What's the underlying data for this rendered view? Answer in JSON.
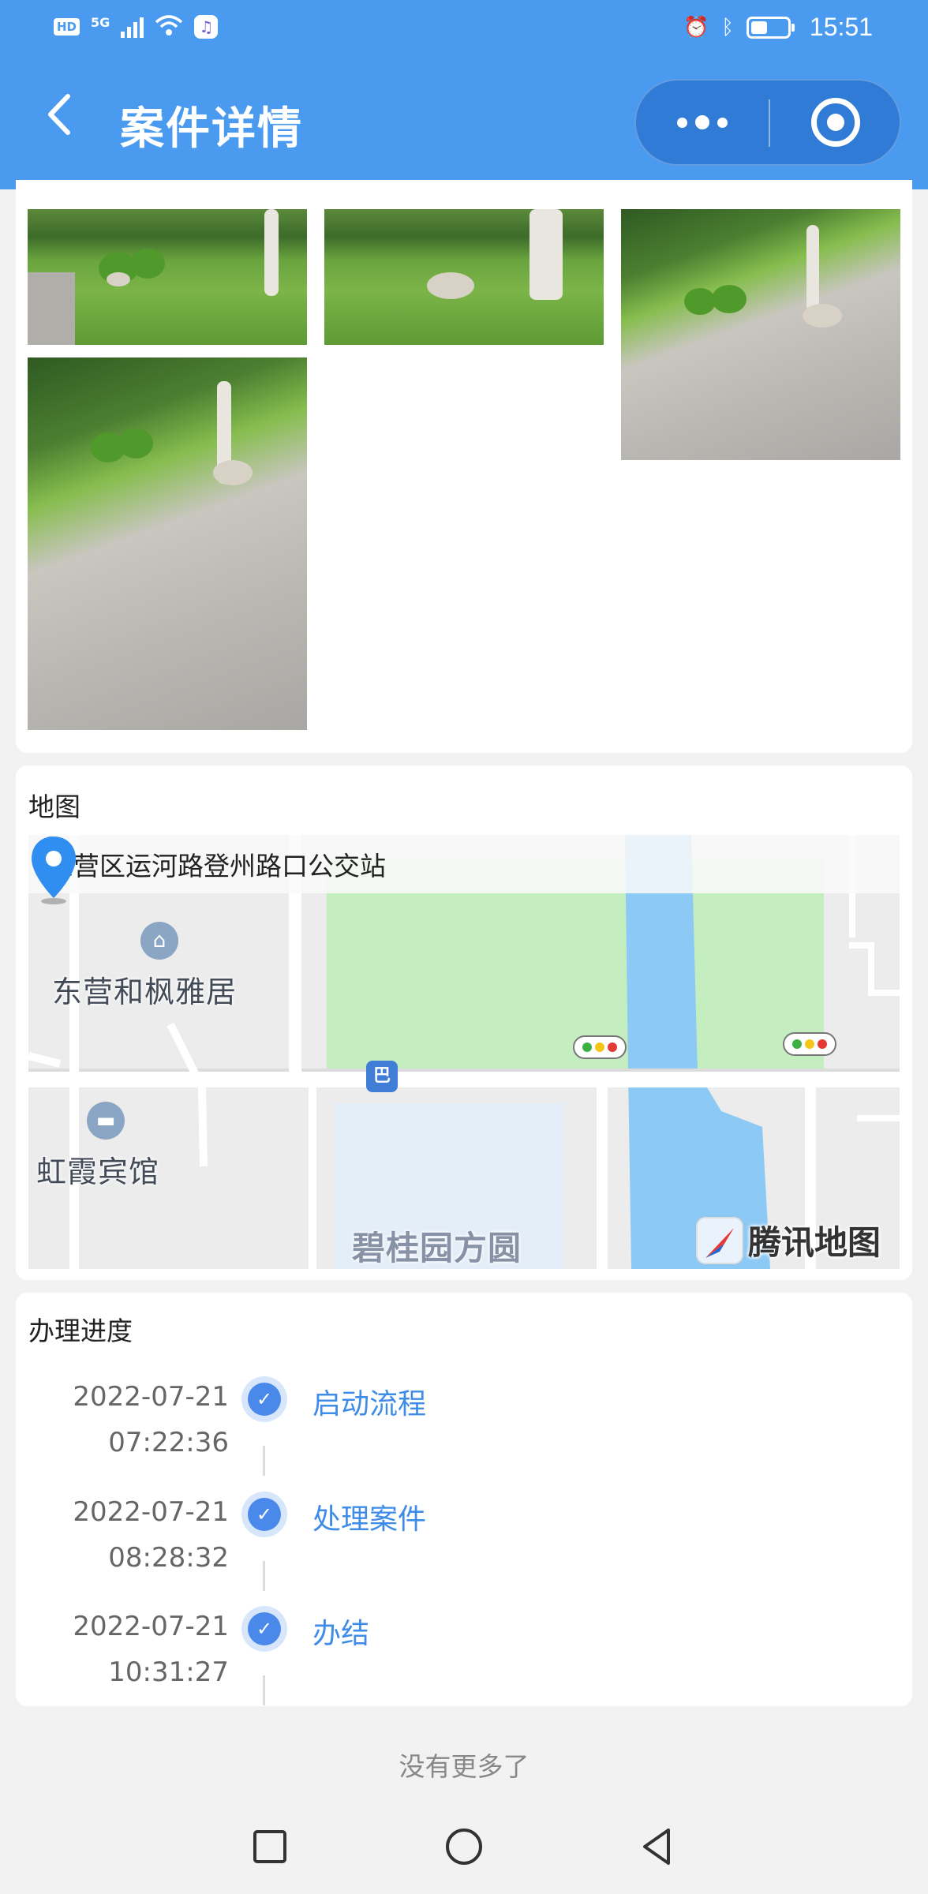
{
  "status_bar": {
    "hd": "HD",
    "network": "5G",
    "time": "15:51",
    "battery_level": 0.45
  },
  "header": {
    "title": "案件详情"
  },
  "photos_section": {
    "photo_count": 4
  },
  "map_section": {
    "title": "地图",
    "address": "东营区运河路登州路口公交站",
    "places": [
      "东营和枫雅居",
      "虹霞宾馆",
      "碧桂园方圆"
    ],
    "brand": "腾讯地图"
  },
  "progress_section": {
    "title": "办理进度",
    "steps": [
      {
        "date": "2022-07-21",
        "time": "07:22:36",
        "label": "启动流程"
      },
      {
        "date": "2022-07-21",
        "time": "08:28:32",
        "label": "处理案件"
      },
      {
        "date": "2022-07-21",
        "time": "10:31:27",
        "label": "办结"
      }
    ]
  },
  "footer": {
    "no_more": "没有更多了"
  },
  "colors": {
    "primary": "#4a9af0",
    "capsule": "#2f7bd5",
    "link": "#3f8ce8",
    "map_park": "#c5eec0",
    "map_water": "#8cc9f5"
  }
}
